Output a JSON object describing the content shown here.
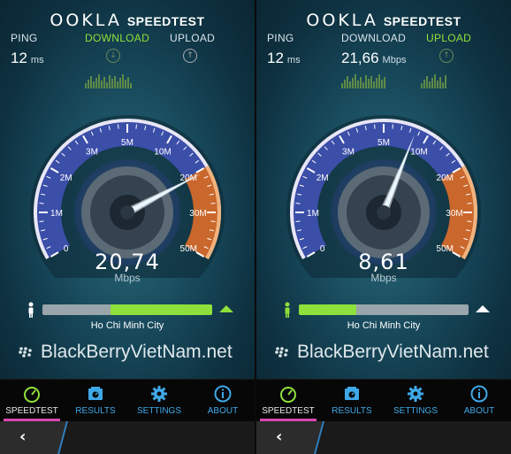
{
  "screens": [
    {
      "logo": {
        "brand": "OOKLA",
        "product": "SPEEDTEST"
      },
      "ping": {
        "label": "PING",
        "value": "12",
        "unit": "ms"
      },
      "download": {
        "label": "DOWNLOAD",
        "value": "",
        "unit": "",
        "active": true
      },
      "upload": {
        "label": "UPLOAD",
        "value": "",
        "unit": "",
        "active": false
      },
      "gauge": {
        "ticks": [
          "0",
          "1M",
          "2M",
          "3M",
          "5M",
          "10M",
          "20M",
          "30M",
          "50M"
        ],
        "needle_value_mbps": 20.74,
        "speed_value": "20,74",
        "speed_unit": "Mbps"
      },
      "progress": {
        "fraction_start": 0.4,
        "fraction_end": 1.0
      },
      "person_color": "#ffffff",
      "triangle_color": "#8ee03a",
      "city": "Ho Chi Minh City",
      "watermark": "BlackBerryVietNam.net"
    },
    {
      "logo": {
        "brand": "OOKLA",
        "product": "SPEEDTEST"
      },
      "ping": {
        "label": "PING",
        "value": "12",
        "unit": "ms"
      },
      "download": {
        "label": "DOWNLOAD",
        "value": "21,66",
        "unit": "Mbps",
        "active": false
      },
      "upload": {
        "label": "UPLOAD",
        "value": "",
        "unit": "",
        "active": true
      },
      "gauge": {
        "ticks": [
          "0",
          "1M",
          "2M",
          "3M",
          "5M",
          "10M",
          "20M",
          "30M",
          "50M"
        ],
        "needle_value_mbps": 8.61,
        "speed_value": "8,61",
        "speed_unit": "Mbps"
      },
      "progress": {
        "fraction_start": 0.0,
        "fraction_end": 0.34
      },
      "person_color": "#8ee03a",
      "triangle_color": "#ffffff",
      "city": "Ho Chi Minh City",
      "watermark": "BlackBerryVietNam.net"
    }
  ],
  "nav": [
    "SPEEDTEST",
    "RESULTS",
    "SETTINGS",
    "ABOUT"
  ],
  "icons": {
    "speedtest": "gauge-icon",
    "results": "results-icon",
    "settings": "gear-icon",
    "about": "info-icon",
    "back": "chevron-left-icon",
    "download_arrow": "download-arrow-icon",
    "upload_arrow": "upload-arrow-icon"
  },
  "colors": {
    "accent_green": "#8ee03a",
    "nav_blue": "#3fa9e8",
    "selected_underline": "#d648b0",
    "gauge_blue": "#3b4ea8",
    "gauge_orange": "#d9793a"
  }
}
